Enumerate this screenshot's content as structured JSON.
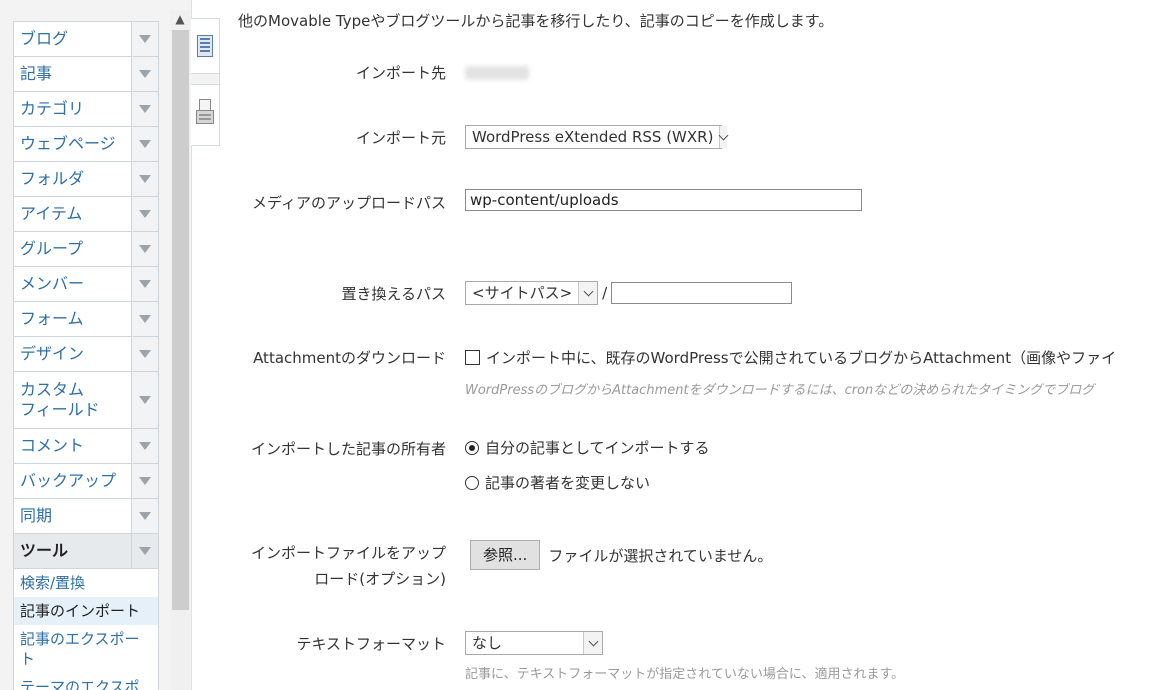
{
  "sidebar": {
    "menu": [
      {
        "label": "ブログ"
      },
      {
        "label": "記事"
      },
      {
        "label": "カテゴリ"
      },
      {
        "label": "ウェブページ"
      },
      {
        "label": "フォルダ"
      },
      {
        "label": "アイテム"
      },
      {
        "label": "グループ"
      },
      {
        "label": "メンバー"
      },
      {
        "label": "フォーム"
      },
      {
        "label": "デザイン"
      },
      {
        "label": "カスタム\nフィールド"
      },
      {
        "label": "コメント"
      },
      {
        "label": "バックアップ"
      },
      {
        "label": "同期"
      },
      {
        "label": "ツール"
      }
    ],
    "tools_subitems": [
      {
        "label": "検索/置換"
      },
      {
        "label": "記事のインポート"
      },
      {
        "label": "記事のエクスポート"
      },
      {
        "label": "テーマのエクスポート"
      }
    ]
  },
  "tabs": {
    "icons": [
      "site-list-icon",
      "document-icon"
    ]
  },
  "main": {
    "intro": "他のMovable Typeやブログツールから記事を移行したり、記事のコピーを作成します。",
    "import_dest": {
      "label": "インポート先"
    },
    "import_source": {
      "label": "インポート元",
      "value": "WordPress eXtended RSS (WXR)"
    },
    "media_path": {
      "label": "メディアのアップロードパス",
      "value": "wp-content/uploads"
    },
    "replace_path": {
      "label": "置き換えるパス",
      "select_value": "<サイトパス>",
      "separator": "/",
      "input_value": ""
    },
    "attachment": {
      "label": "Attachmentのダウンロード",
      "checkbox_text": "インポート中に、既存のWordPressで公開されているブログからAttachment（画像やファイ",
      "hint": "WordPressのブログからAttachmentをダウンロードするには、cronなどの決められたタイミングでブログ"
    },
    "owner": {
      "label": "インポートした記事の所有者",
      "options": [
        {
          "text": "自分の記事としてインポートする",
          "checked": true
        },
        {
          "text": "記事の著者を変更しない",
          "checked": false
        }
      ]
    },
    "upload": {
      "label": "インポートファイルをアップロード(オプション)",
      "button": "参照...",
      "status": "ファイルが選択されていません。"
    },
    "text_format": {
      "label": "テキストフォーマット",
      "value": "なし",
      "hint": "記事に、テキストフォーマットが指定されていない場合に、適用されます。"
    }
  }
}
